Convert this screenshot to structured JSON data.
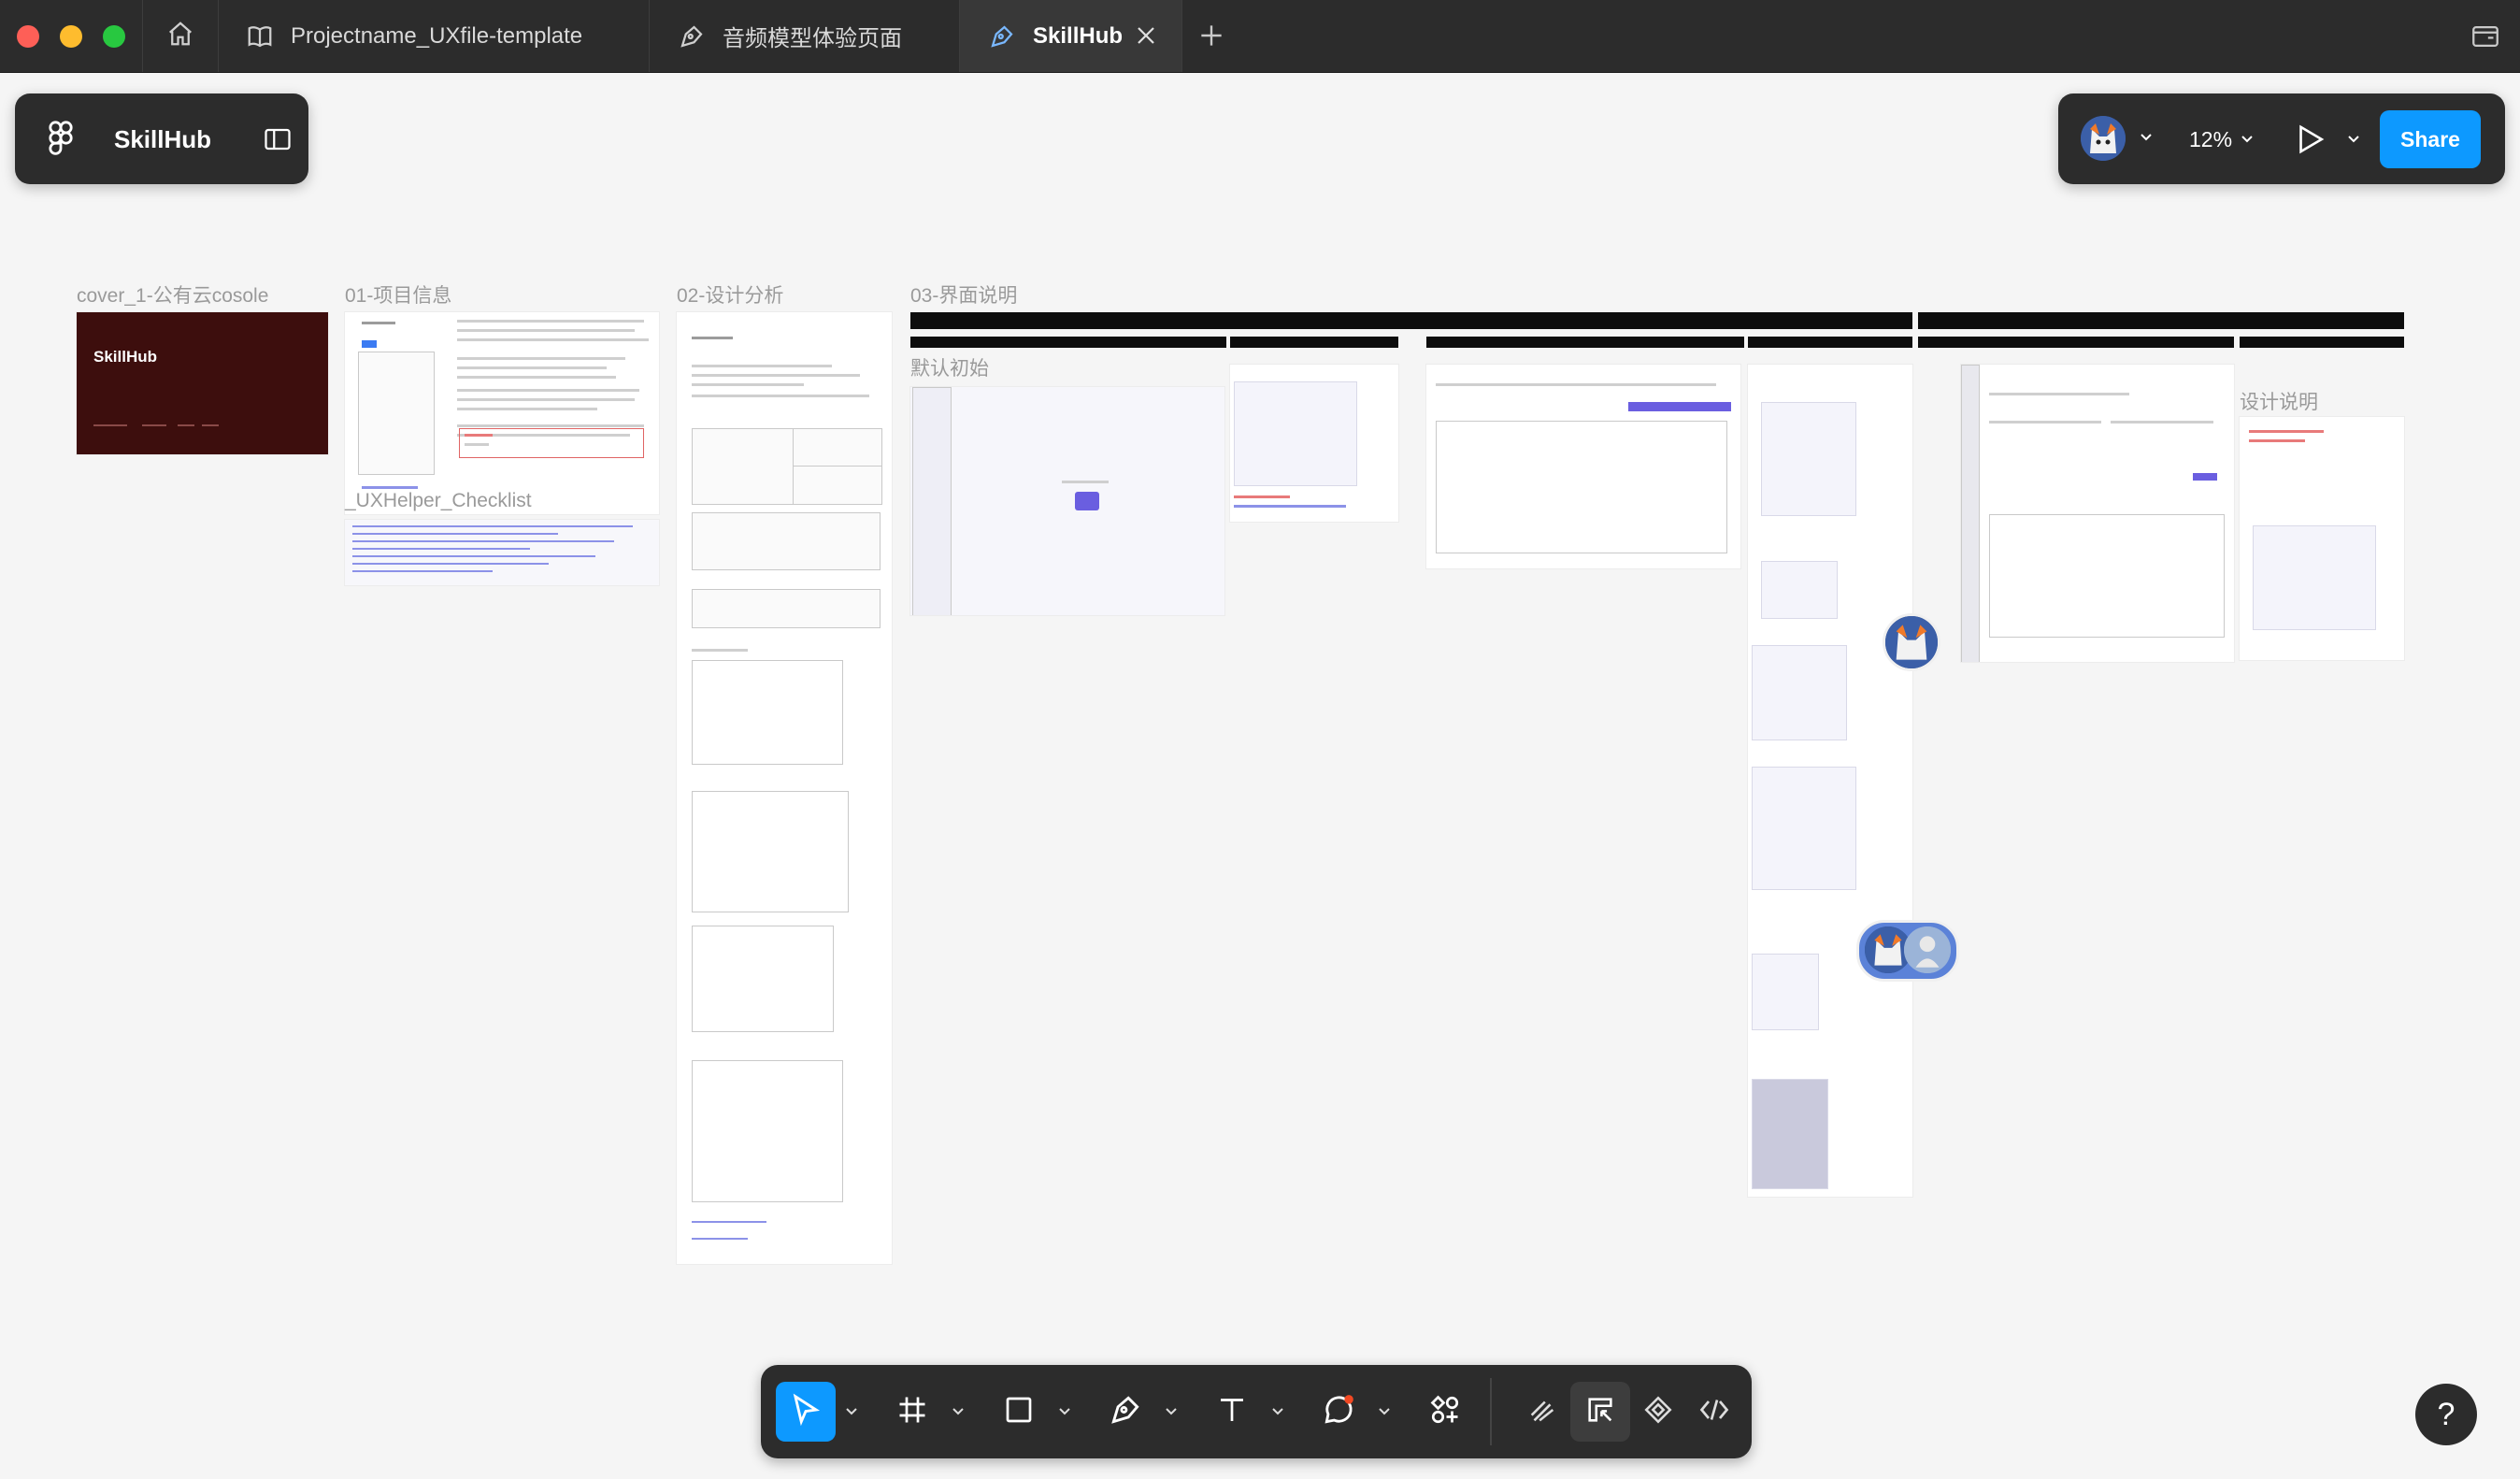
{
  "tabs": {
    "tab1": "Projectname_UXfile-template",
    "tab2": "音频模型体验页面",
    "tab3": "SkillHub"
  },
  "toolbar": {
    "file_name": "SkillHub",
    "zoom": "12%",
    "share_label": "Share"
  },
  "canvas": {
    "frames": {
      "cover": "cover_1-公有云cosole",
      "cover_title": "SkillHub",
      "project": "01-项目信息",
      "checklist": "_UXHelper_Checklist",
      "analysis": "02-设计分析",
      "interface": "03-界面说明",
      "initial": "默认初始",
      "design_note": "设计说明"
    }
  },
  "help_label": "?",
  "colors": {
    "chrome_dark": "#2c2c2c",
    "accent_blue": "#0d99ff",
    "cover_red": "#3d0e0d",
    "canvas_bg": "#f5f5f5"
  }
}
